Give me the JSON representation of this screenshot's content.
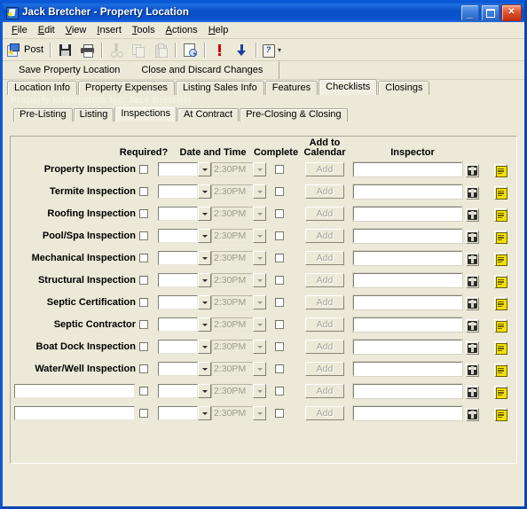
{
  "window": {
    "title": "Jack Bretcher  -  Property Location",
    "icon": "document-arrow-icon",
    "controls": {
      "minimize": "_",
      "maximize": "maximize-icon",
      "close": "✕"
    }
  },
  "menubar": {
    "items": [
      {
        "label": "File",
        "accel": "F"
      },
      {
        "label": "Edit",
        "accel": "E"
      },
      {
        "label": "View",
        "accel": "V"
      },
      {
        "label": "Insert",
        "accel": "I"
      },
      {
        "label": "Tools",
        "accel": "T"
      },
      {
        "label": "Actions",
        "accel": "A"
      },
      {
        "label": "Help",
        "accel": "H"
      }
    ]
  },
  "toolbar": {
    "post_label": "Post",
    "buttons": [
      {
        "name": "post-button",
        "icon": "post-icon",
        "enabled": true
      },
      {
        "name": "save-button",
        "icon": "save-icon",
        "enabled": true
      },
      {
        "name": "print-button",
        "icon": "print-icon",
        "enabled": true
      },
      {
        "name": "cut-button",
        "icon": "scissors-icon",
        "enabled": false
      },
      {
        "name": "copy-button",
        "icon": "copy-icon",
        "enabled": false
      },
      {
        "name": "paste-button",
        "icon": "paste-icon",
        "enabled": false
      },
      {
        "name": "print-preview-button",
        "icon": "preview-icon",
        "enabled": true
      },
      {
        "name": "priority-button",
        "icon": "exclamation-icon",
        "enabled": true
      },
      {
        "name": "move-down-button",
        "icon": "down-arrow-icon",
        "enabled": true
      },
      {
        "name": "help-button",
        "icon": "help-icon",
        "enabled": true
      }
    ],
    "help_glyph": "?"
  },
  "actionbar": {
    "save": "Save Property Location",
    "close": "Close and Discard Changes"
  },
  "tabs": {
    "items": [
      "Location Info",
      "Property Expenses",
      "Listing Sales Info",
      "Features",
      "Checklists",
      "Closings"
    ],
    "active": "Checklists"
  },
  "banner": {
    "text": "Property Information for: Jack Bretcher"
  },
  "subtabs": {
    "items": [
      "Pre-Listing",
      "Listing",
      "Inspections",
      "At Contract",
      "Pre-Closing & Closing"
    ],
    "active": "Inspections"
  },
  "grid": {
    "headers": {
      "required": "Required?",
      "date_time": "Date and Time",
      "complete": "Complete",
      "add_to_calendar_line1": "Add to",
      "add_to_calendar_line2": "Calendar",
      "inspector": "Inspector"
    },
    "add_button_label": "Add",
    "time_placeholder": "2:30PM",
    "row_icons": [
      {
        "name": "address-book-icon"
      },
      {
        "name": "notes-icon"
      }
    ],
    "rows": [
      {
        "label": "Property Inspection",
        "editable_label": false,
        "required": false,
        "date": "",
        "time": "2:30PM",
        "complete": false,
        "inspector": ""
      },
      {
        "label": "Termite Inspection",
        "editable_label": false,
        "required": false,
        "date": "",
        "time": "2:30PM",
        "complete": false,
        "inspector": ""
      },
      {
        "label": "Roofing Inspection",
        "editable_label": false,
        "required": false,
        "date": "",
        "time": "2:30PM",
        "complete": false,
        "inspector": ""
      },
      {
        "label": "Pool/Spa Inspection",
        "editable_label": false,
        "required": false,
        "date": "",
        "time": "2:30PM",
        "complete": false,
        "inspector": ""
      },
      {
        "label": "Mechanical Inspection",
        "editable_label": false,
        "required": false,
        "date": "",
        "time": "2:30PM",
        "complete": false,
        "inspector": ""
      },
      {
        "label": "Structural Inspection",
        "editable_label": false,
        "required": false,
        "date": "",
        "time": "2:30PM",
        "complete": false,
        "inspector": ""
      },
      {
        "label": "Septic Certification",
        "editable_label": false,
        "required": false,
        "date": "",
        "time": "2:30PM",
        "complete": false,
        "inspector": ""
      },
      {
        "label": "Septic Contractor",
        "editable_label": false,
        "required": false,
        "date": "",
        "time": "2:30PM",
        "complete": false,
        "inspector": ""
      },
      {
        "label": "Boat Dock Inspection",
        "editable_label": false,
        "required": false,
        "date": "",
        "time": "2:30PM",
        "complete": false,
        "inspector": ""
      },
      {
        "label": "Water/Well Inspection",
        "editable_label": false,
        "required": false,
        "date": "",
        "time": "2:30PM",
        "complete": false,
        "inspector": ""
      },
      {
        "label": "",
        "editable_label": true,
        "required": false,
        "date": "",
        "time": "2:30PM",
        "complete": false,
        "inspector": ""
      },
      {
        "label": "",
        "editable_label": true,
        "required": false,
        "date": "",
        "time": "2:30PM",
        "complete": false,
        "inspector": ""
      }
    ]
  },
  "colors": {
    "titlebar_blue": "#0a4fc8",
    "face": "#ece9d8",
    "border": "#aca899",
    "note_yellow": "#f2e000",
    "banner_text": "#f4f2e8"
  }
}
